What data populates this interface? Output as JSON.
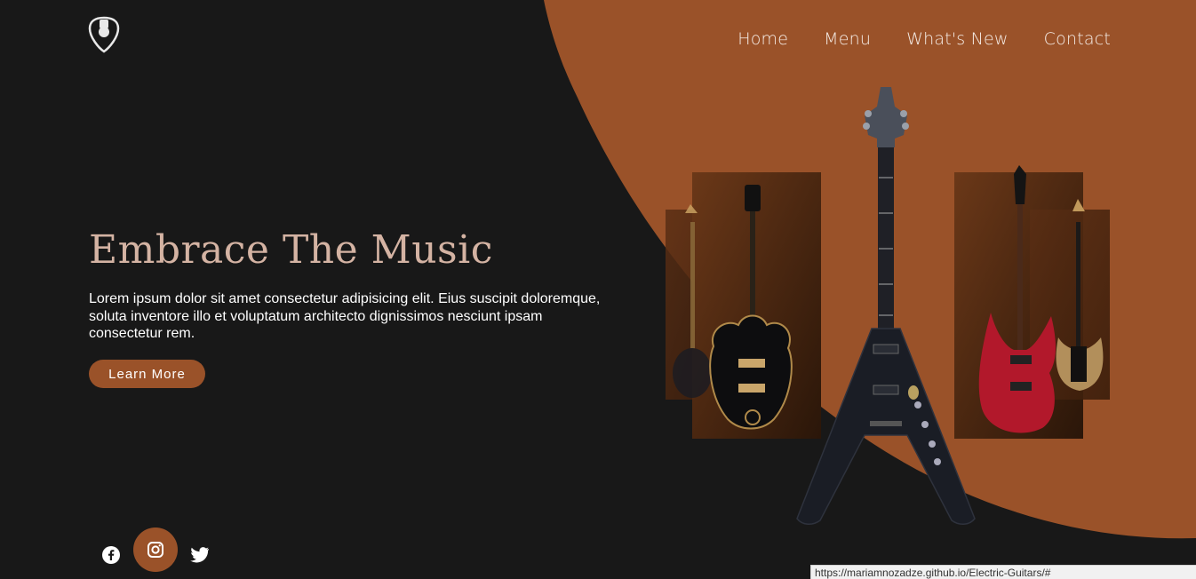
{
  "nav": {
    "items": [
      {
        "label": "Home"
      },
      {
        "label": "Menu"
      },
      {
        "label": "What's New"
      },
      {
        "label": "Contact"
      }
    ]
  },
  "hero": {
    "title": "Embrace The Music",
    "body": "Lorem ipsum dolor sit amet consectetur adipisicing elit. Eius suscipit doloremque, soluta inventore illo et voluptatum architecto dignissimos nesciunt ipsam consectetur rem.",
    "cta_label": "Learn More"
  },
  "social": {
    "icons": [
      "facebook-icon",
      "instagram-icon",
      "twitter-icon"
    ]
  },
  "status_bar": {
    "url": "https://mariamnozadze.github.io/Electric-Guitars/#"
  },
  "colors": {
    "background": "#181818",
    "accent": "#9a5229",
    "title": "#d4b3a3",
    "text": "#ffffff"
  }
}
